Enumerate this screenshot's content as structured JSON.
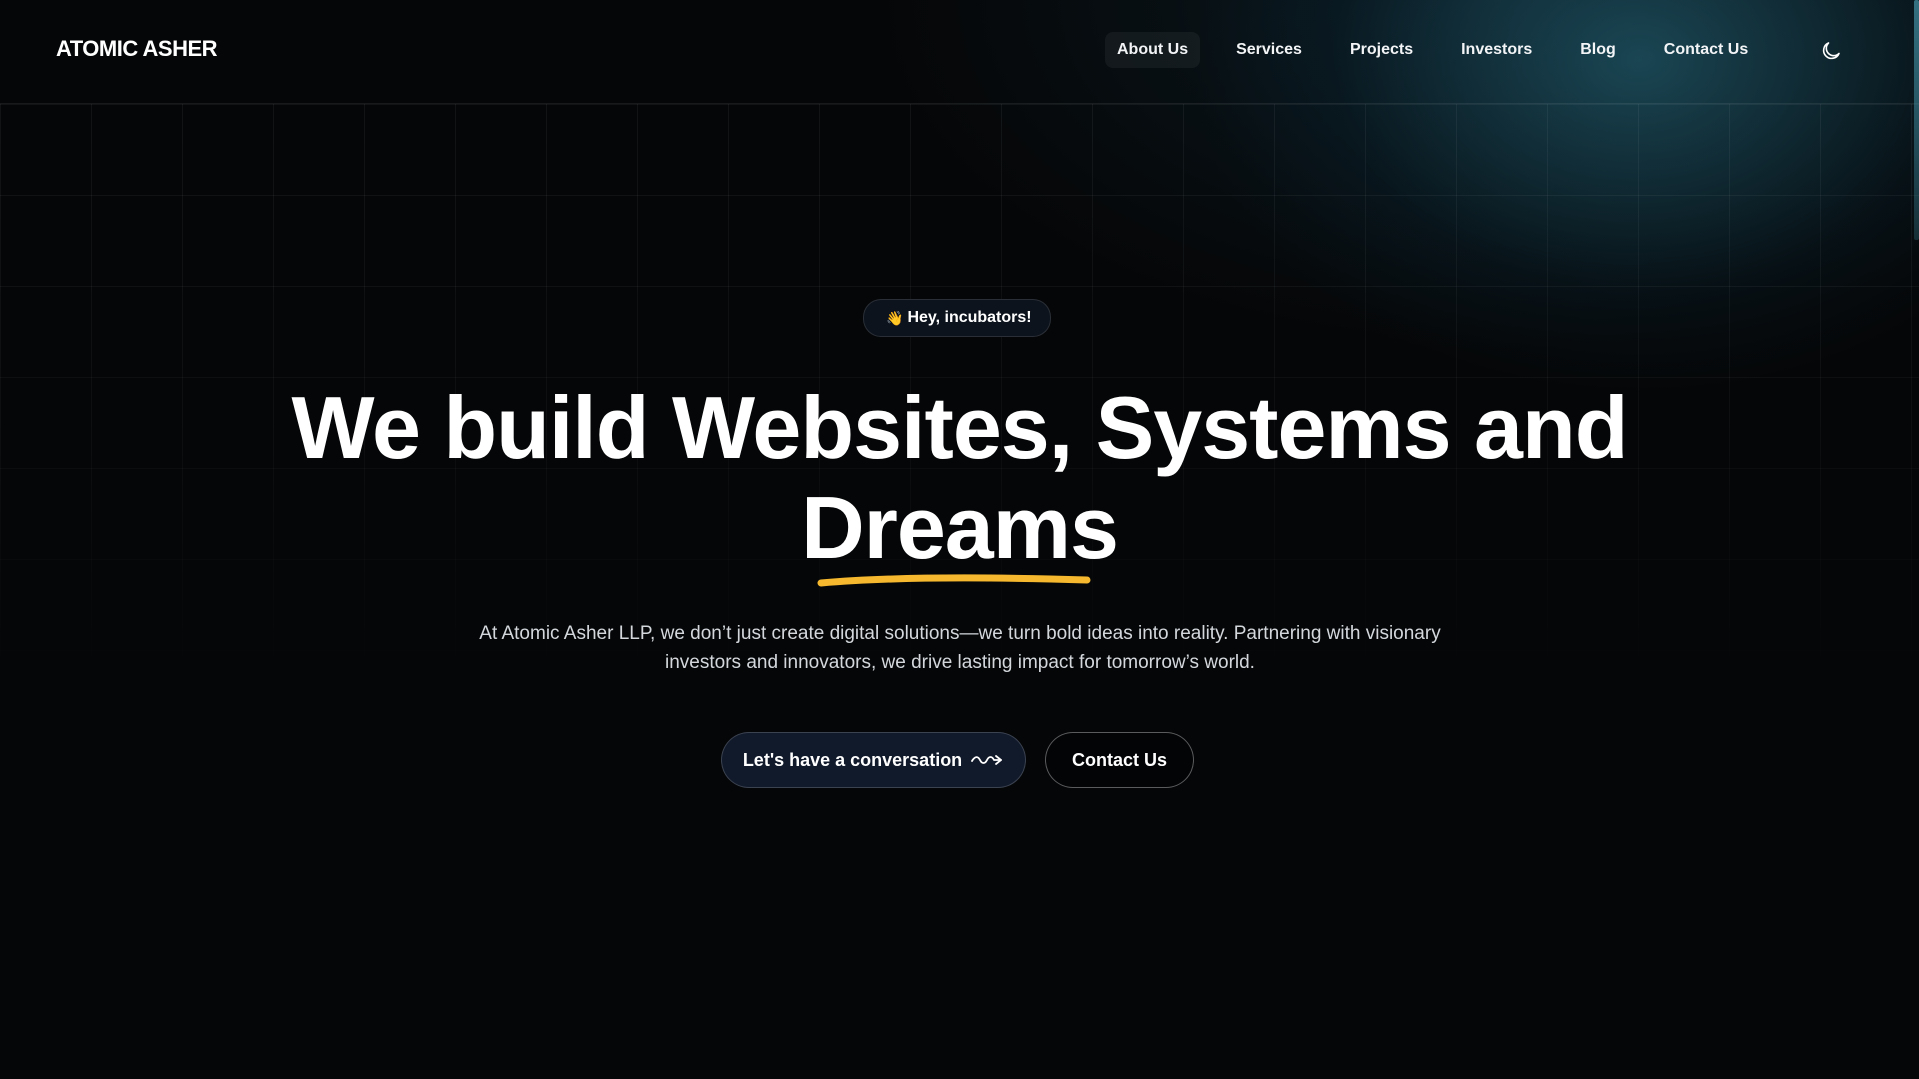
{
  "brand": {
    "name": "ATOMIC ASHER"
  },
  "nav": {
    "items": [
      {
        "label": "About Us",
        "active": true
      },
      {
        "label": "Services",
        "active": false
      },
      {
        "label": "Projects",
        "active": false
      },
      {
        "label": "Investors",
        "active": false
      },
      {
        "label": "Blog",
        "active": false
      },
      {
        "label": "Contact Us",
        "active": false
      }
    ],
    "theme_toggle_icon": "moon-icon"
  },
  "hero": {
    "greeting": "Hey, incubators!",
    "greeting_icon": "waving-hand-icon",
    "headline_line1": "We build Websites, Systems and",
    "headline_highlight": "Dreams",
    "description": "At Atomic Asher LLP, we don’t just create digital solutions—we turn bold ideas into reality. Partnering with visionary investors and innovators, we drive lasting impact for tomorrow’s world.",
    "primary_cta": "Let's have a conversation",
    "primary_cta_icon": "squiggle-arrow-icon",
    "secondary_cta": "Contact Us"
  },
  "colors": {
    "background": "#050607",
    "accent_underline": "#f5b82e",
    "primary_button_bg": "#111a2b",
    "glow": "#2a6e82"
  }
}
